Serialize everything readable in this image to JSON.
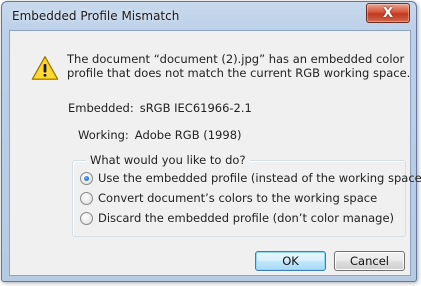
{
  "window": {
    "title": "Embedded Profile Mismatch",
    "close_glyph": "X"
  },
  "message": {
    "icon": "warning-icon",
    "line1": "The document “document (2).jpg” has an embedded color",
    "line2": "profile that does not match the current RGB working space."
  },
  "profiles": {
    "embedded_label": "Embedded:",
    "embedded_value": "sRGB IEC61966-2.1",
    "working_label": "Working:",
    "working_value": "Adobe RGB (1998)"
  },
  "options": {
    "legend": "What would you like to do?",
    "items": [
      {
        "label": "Use the embedded profile (instead of the working space)",
        "selected": true
      },
      {
        "label": "Convert document’s colors to the working space",
        "selected": false
      },
      {
        "label": "Discard the embedded profile (don’t color manage)",
        "selected": false
      }
    ]
  },
  "buttons": {
    "ok": "OK",
    "cancel": "Cancel"
  },
  "colors": {
    "title_bar": "#bcd0e8",
    "close_button": "#c0391f",
    "dialog_background": "#f0f0f0",
    "warning_yellow": "#f5c400",
    "radio_selected": "#1f6fd1"
  }
}
